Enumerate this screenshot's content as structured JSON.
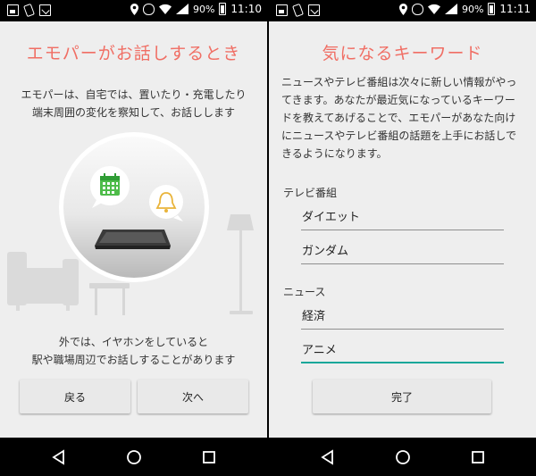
{
  "colors": {
    "accent_title": "#f06e64",
    "accent_field": "#16a79a",
    "background": "#eeeeee"
  },
  "left": {
    "status": {
      "battery": "90%",
      "time": "11:10"
    },
    "title": "エモパーがお話しするとき",
    "desc_line1": "エモパーは、自宅では、置いたり・充電したり",
    "desc_line2": "端末周囲の変化を察知して、お話しします",
    "desc2_line1": "外では、イヤホンをしていると",
    "desc2_line2": "駅や職場周辺でお話しすることがあります",
    "back_label": "戻る",
    "next_label": "次へ",
    "icons": [
      "calendar-icon",
      "bell-icon",
      "smartphone-icon",
      "sofa-icon",
      "table-icon",
      "floor-lamp-icon"
    ]
  },
  "right": {
    "status": {
      "battery": "90%",
      "time": "11:11"
    },
    "title": "気になるキーワード",
    "desc": "ニュースやテレビ番組は次々に新しい情報がやってきます。あなたが最近気になっているキーワードを教えてあげることで、エモパーがあなた向けにニュースやテレビ番組の話題を上手にお話しできるようになります。",
    "tv_label": "テレビ番組",
    "tv_value1": "ダイエット",
    "tv_value2": "ガンダム",
    "news_label": "ニュース",
    "news_value1": "経済",
    "news_value2": "アニメ",
    "done_label": "完了"
  }
}
